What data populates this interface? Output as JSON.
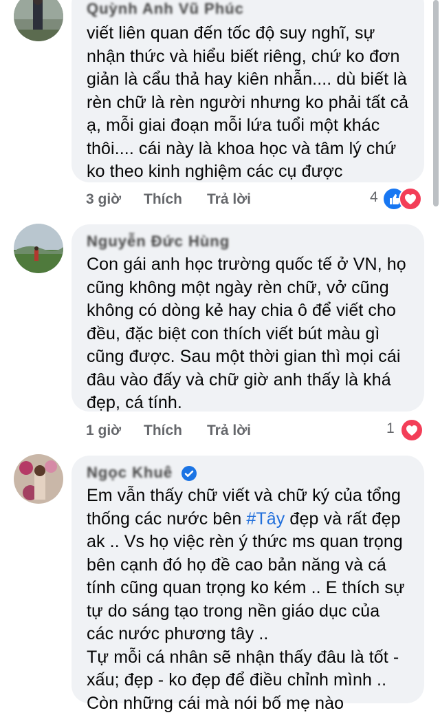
{
  "comments": [
    {
      "author": "Quỳnh Anh Vũ Phúc",
      "lines": [
        "viết liên quan đến tốc độ suy nghĩ, sự",
        "nhận thức và hiểu biết riêng, chứ ko đơn",
        "giản là cẩu thả hay kiên nhẫn.... dù biết là",
        "rèn chữ là rèn người nhưng ko phải tất cả",
        "ạ, mỗi giai đoạn mỗi lứa tuổi một khác",
        "thôi.... cái này là khoa học và tâm lý chứ",
        "ko theo kinh nghiệm các cụ được"
      ],
      "time": "3 giờ",
      "like_label": "Thích",
      "reply_label": "Trả lời",
      "reaction_count": "4",
      "reactions": [
        "like-icon",
        "love-icon"
      ]
    },
    {
      "author": "Nguyễn Đức Hùng",
      "lines": [
        "Con gái anh học trường quốc tế ở VN, họ",
        "cũng không một ngày rèn chữ, vở cũng",
        "không có dòng kẻ hay chia ô để viết cho",
        "đều, đặc biệt con thích viết bút màu gì",
        "cũng được. Sau một thời gian thì mọi cái",
        "đâu vào đấy và chữ giờ anh thấy là khá",
        "đẹp, cá tính."
      ],
      "time": "1 giờ",
      "like_label": "Thích",
      "reply_label": "Trả lời",
      "reaction_count": "1",
      "reactions": [
        "love-icon"
      ]
    },
    {
      "author": "Ngọc Khuê",
      "lines_before_tag": "Em vẫn thấy chữ viết và chữ ký của tổng",
      "line2_prefix": "thống các nước bên ",
      "hashtag": "#Tây",
      "line2_suffix": " đẹp và rất đẹp",
      "lines": [
        "ak .. Vs họ việc rèn ý thức ms quan trọng",
        "bên cạnh đó họ đề cao bản năng và cá",
        "tính cũng quan trọng ko kém .. E thích sự",
        "tự do sáng tạo trong nền giáo dục của",
        "các nước phương tây ..",
        "Tự mỗi cá nhân sẽ nhận thấy đâu là tốt -",
        "xấu; đẹp - ko đẹp để điều chỉnh mình ..",
        "Còn những cái mà nói bố mẹ nào"
      ]
    }
  ]
}
